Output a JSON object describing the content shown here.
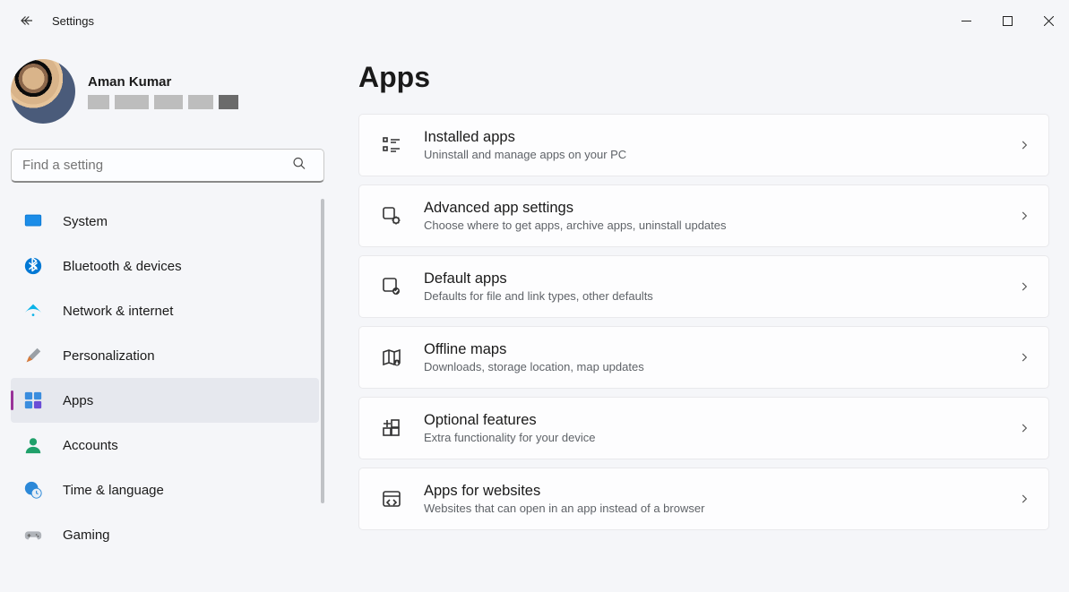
{
  "titlebar": {
    "title": "Settings"
  },
  "profile": {
    "name": "Aman Kumar"
  },
  "search": {
    "placeholder": "Find a setting"
  },
  "nav": {
    "items": [
      {
        "label": "System"
      },
      {
        "label": "Bluetooth & devices"
      },
      {
        "label": "Network & internet"
      },
      {
        "label": "Personalization"
      },
      {
        "label": "Apps"
      },
      {
        "label": "Accounts"
      },
      {
        "label": "Time & language"
      },
      {
        "label": "Gaming"
      }
    ]
  },
  "page": {
    "title": "Apps"
  },
  "cards": [
    {
      "title": "Installed apps",
      "desc": "Uninstall and manage apps on your PC"
    },
    {
      "title": "Advanced app settings",
      "desc": "Choose where to get apps, archive apps, uninstall updates"
    },
    {
      "title": "Default apps",
      "desc": "Defaults for file and link types, other defaults"
    },
    {
      "title": "Offline maps",
      "desc": "Downloads, storage location, map updates"
    },
    {
      "title": "Optional features",
      "desc": "Extra functionality for your device"
    },
    {
      "title": "Apps for websites",
      "desc": "Websites that can open in an app instead of a browser"
    }
  ]
}
